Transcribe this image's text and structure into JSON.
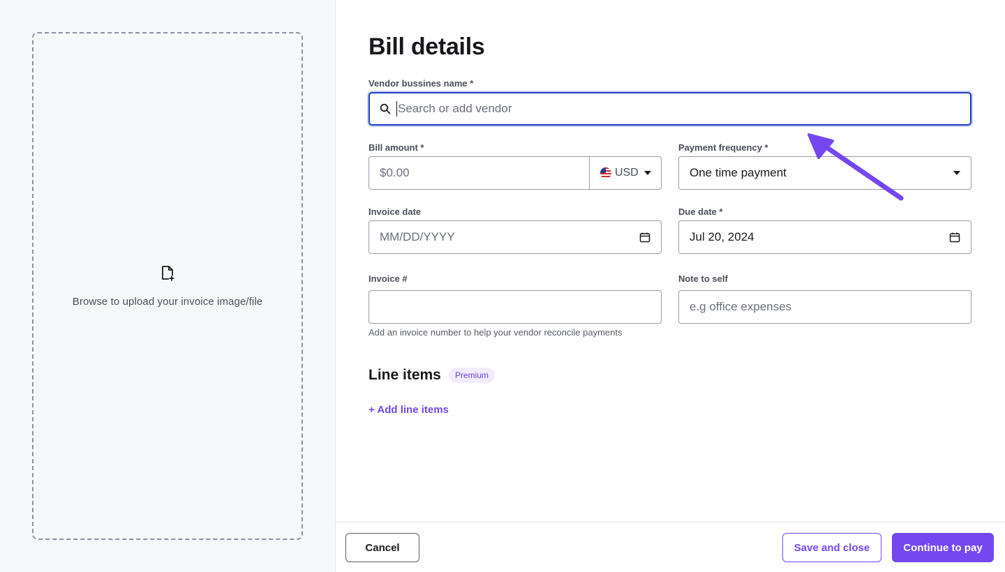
{
  "upload": {
    "text": "Browse to upload your invoice image/file",
    "icon": "file-plus-icon"
  },
  "form": {
    "title": "Bill details",
    "vendor": {
      "label": "Vendor bussines name *",
      "placeholder": "Search or add vendor",
      "icon": "search-icon"
    },
    "bill_amount": {
      "label": "Bill amount *",
      "placeholder": "$0.00",
      "currency": "USD",
      "currency_icon": "us-flag-icon"
    },
    "payment_frequency": {
      "label": "Payment frequency *",
      "value": "One time payment"
    },
    "invoice_date": {
      "label": "Invoice date",
      "placeholder": "MM/DD/YYYY",
      "icon": "calendar-icon"
    },
    "due_date": {
      "label": "Due date *",
      "value": "Jul 20, 2024",
      "icon": "calendar-icon"
    },
    "invoice_number": {
      "label": "Invoice #",
      "value": "",
      "helper": "Add an invoice number to help your vendor reconcile payments"
    },
    "note": {
      "label": "Note to self",
      "placeholder": "e.g office expenses"
    },
    "line_items": {
      "title": "Line items",
      "badge": "Premium",
      "add_label": "+ Add line items"
    }
  },
  "footer": {
    "cancel": "Cancel",
    "save_close": "Save and close",
    "continue": "Continue to pay"
  },
  "colors": {
    "accent": "#7547f0",
    "focus_border": "#1f3fbf",
    "left_panel_bg": "#f7f8fa"
  }
}
